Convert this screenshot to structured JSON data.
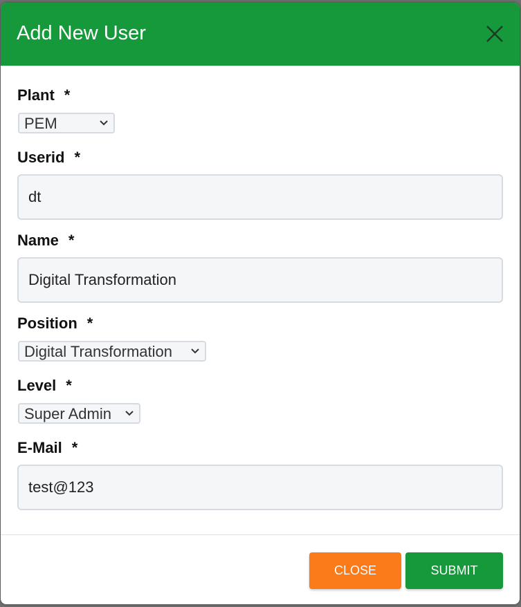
{
  "modal": {
    "title": "Add New User",
    "header_color": "#16993a"
  },
  "form": {
    "plant": {
      "label": "Plant",
      "required": "*",
      "value": "PEM"
    },
    "userid": {
      "label": "Userid",
      "required": "*",
      "value": "dt"
    },
    "name": {
      "label": "Name",
      "required": "*",
      "value": "Digital Transformation"
    },
    "position": {
      "label": "Position",
      "required": "*",
      "value": "Digital Transformation"
    },
    "level": {
      "label": "Level",
      "required": "*",
      "value": "Super Admin"
    },
    "email": {
      "label": "E-Mail",
      "required": "*",
      "value": "test@123"
    }
  },
  "footer": {
    "close_label": "CLOSE",
    "submit_label": "SUBMIT",
    "close_color": "#fb7a19",
    "submit_color": "#16993a"
  },
  "icons": {
    "close": "close-icon",
    "dropdown": "chevron-down-icon"
  }
}
